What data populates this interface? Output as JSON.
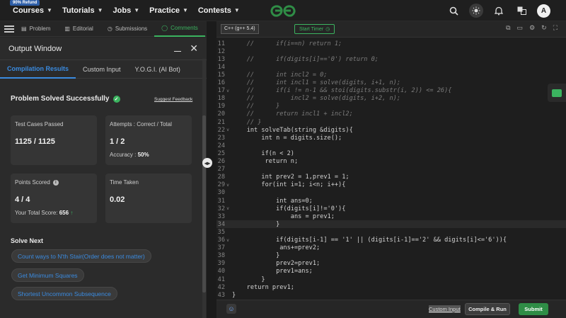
{
  "topnav": {
    "badge": "90% Refund",
    "items": [
      "Courses",
      "Tutorials",
      "Jobs",
      "Practice",
      "Contests"
    ],
    "avatar": "A"
  },
  "left_tabs": {
    "problem": "Problem",
    "editorial": "Editorial",
    "submissions": "Submissions",
    "comments": "Comments"
  },
  "output": {
    "title": "Output Window",
    "tabs": [
      "Compilation Results",
      "Custom Input",
      "Y.O.G.I. (AI Bot)"
    ],
    "status": "Problem Solved Successfully",
    "suggest": "Suggest Feedback",
    "cards": {
      "tests_label": "Test Cases Passed",
      "tests_value": "1125 / 1125",
      "attempts_label": "Attempts : Correct / Total",
      "attempts_value": "1 / 2",
      "accuracy_label": "Accuracy :",
      "accuracy_value": "50%",
      "points_label": "Points Scored",
      "points_value": "4 / 4",
      "total_label": "Your Total Score:",
      "total_value": "656",
      "time_label": "Time Taken",
      "time_value": "0.02"
    },
    "solve_next_title": "Solve Next",
    "solve_next": [
      "Count ways to N'th Stair(Order does not matter)",
      "Get Minimum Squares",
      "Shortest Uncommon Subsequence"
    ]
  },
  "editor": {
    "language": "C++ (g++ 5.4)",
    "timer": "Start Timer",
    "lines": [
      {
        "n": "11",
        "t": "    //      if(i==n) return 1;",
        "c": true,
        "f": ""
      },
      {
        "n": "12",
        "t": "",
        "c": false,
        "f": ""
      },
      {
        "n": "13",
        "t": "    //      if(digits[i]=='0') return 0;",
        "c": true,
        "f": ""
      },
      {
        "n": "14",
        "t": "",
        "c": false,
        "f": ""
      },
      {
        "n": "15",
        "t": "    //      int incl2 = 0;",
        "c": true,
        "f": ""
      },
      {
        "n": "16",
        "t": "    //      int incl1 = solve(digits, i+1, n);",
        "c": true,
        "f": ""
      },
      {
        "n": "17",
        "t": "    //      if(i != n-1 && stoi(digits.substr(i, 2)) <= 26){",
        "c": true,
        "f": "v"
      },
      {
        "n": "18",
        "t": "    //          incl2 = solve(digits, i+2, n);",
        "c": true,
        "f": ""
      },
      {
        "n": "19",
        "t": "    //      }",
        "c": true,
        "f": ""
      },
      {
        "n": "20",
        "t": "    //      return incl1 + incl2;",
        "c": true,
        "f": ""
      },
      {
        "n": "21",
        "t": "    // }",
        "c": true,
        "f": ""
      },
      {
        "n": "22",
        "t": "    int solveTab(string &digits){",
        "c": false,
        "f": "v"
      },
      {
        "n": "23",
        "t": "        int n = digits.size();",
        "c": false,
        "f": ""
      },
      {
        "n": "24",
        "t": "",
        "c": false,
        "f": ""
      },
      {
        "n": "25",
        "t": "        if(n < 2)",
        "c": false,
        "f": ""
      },
      {
        "n": "26",
        "t": "         return n;",
        "c": false,
        "f": ""
      },
      {
        "n": "27",
        "t": "",
        "c": false,
        "f": ""
      },
      {
        "n": "28",
        "t": "        int prev2 = 1,prev1 = 1;",
        "c": false,
        "f": ""
      },
      {
        "n": "29",
        "t": "        for(int i=1; i<n; i++){",
        "c": false,
        "f": "v"
      },
      {
        "n": "30",
        "t": "",
        "c": false,
        "f": ""
      },
      {
        "n": "31",
        "t": "            int ans=0;",
        "c": false,
        "f": ""
      },
      {
        "n": "32",
        "t": "            if(digits[i]!='0'){",
        "c": false,
        "f": "v"
      },
      {
        "n": "33",
        "t": "                ans = prev1;",
        "c": false,
        "f": ""
      },
      {
        "n": "34",
        "t": "            }",
        "c": false,
        "f": ""
      },
      {
        "n": "35",
        "t": "",
        "c": false,
        "f": ""
      },
      {
        "n": "36",
        "t": "            if(digits[i-1] == '1' || (digits[i-1]=='2' && digits[i]<='6')){",
        "c": false,
        "f": "v"
      },
      {
        "n": "37",
        "t": "             ans+=prev2;",
        "c": false,
        "f": ""
      },
      {
        "n": "38",
        "t": "            }",
        "c": false,
        "f": ""
      },
      {
        "n": "39",
        "t": "            prev2=prev1;",
        "c": false,
        "f": ""
      },
      {
        "n": "40",
        "t": "            prev1=ans;",
        "c": false,
        "f": ""
      },
      {
        "n": "41",
        "t": "        }",
        "c": false,
        "f": ""
      },
      {
        "n": "42",
        "t": "    return prev1;",
        "c": false,
        "f": ""
      },
      {
        "n": "43",
        "t": "}",
        "c": false,
        "f": ""
      }
    ],
    "custom_input": "Custom Input",
    "compile_run": "Compile & Run",
    "submit": "Submit"
  }
}
